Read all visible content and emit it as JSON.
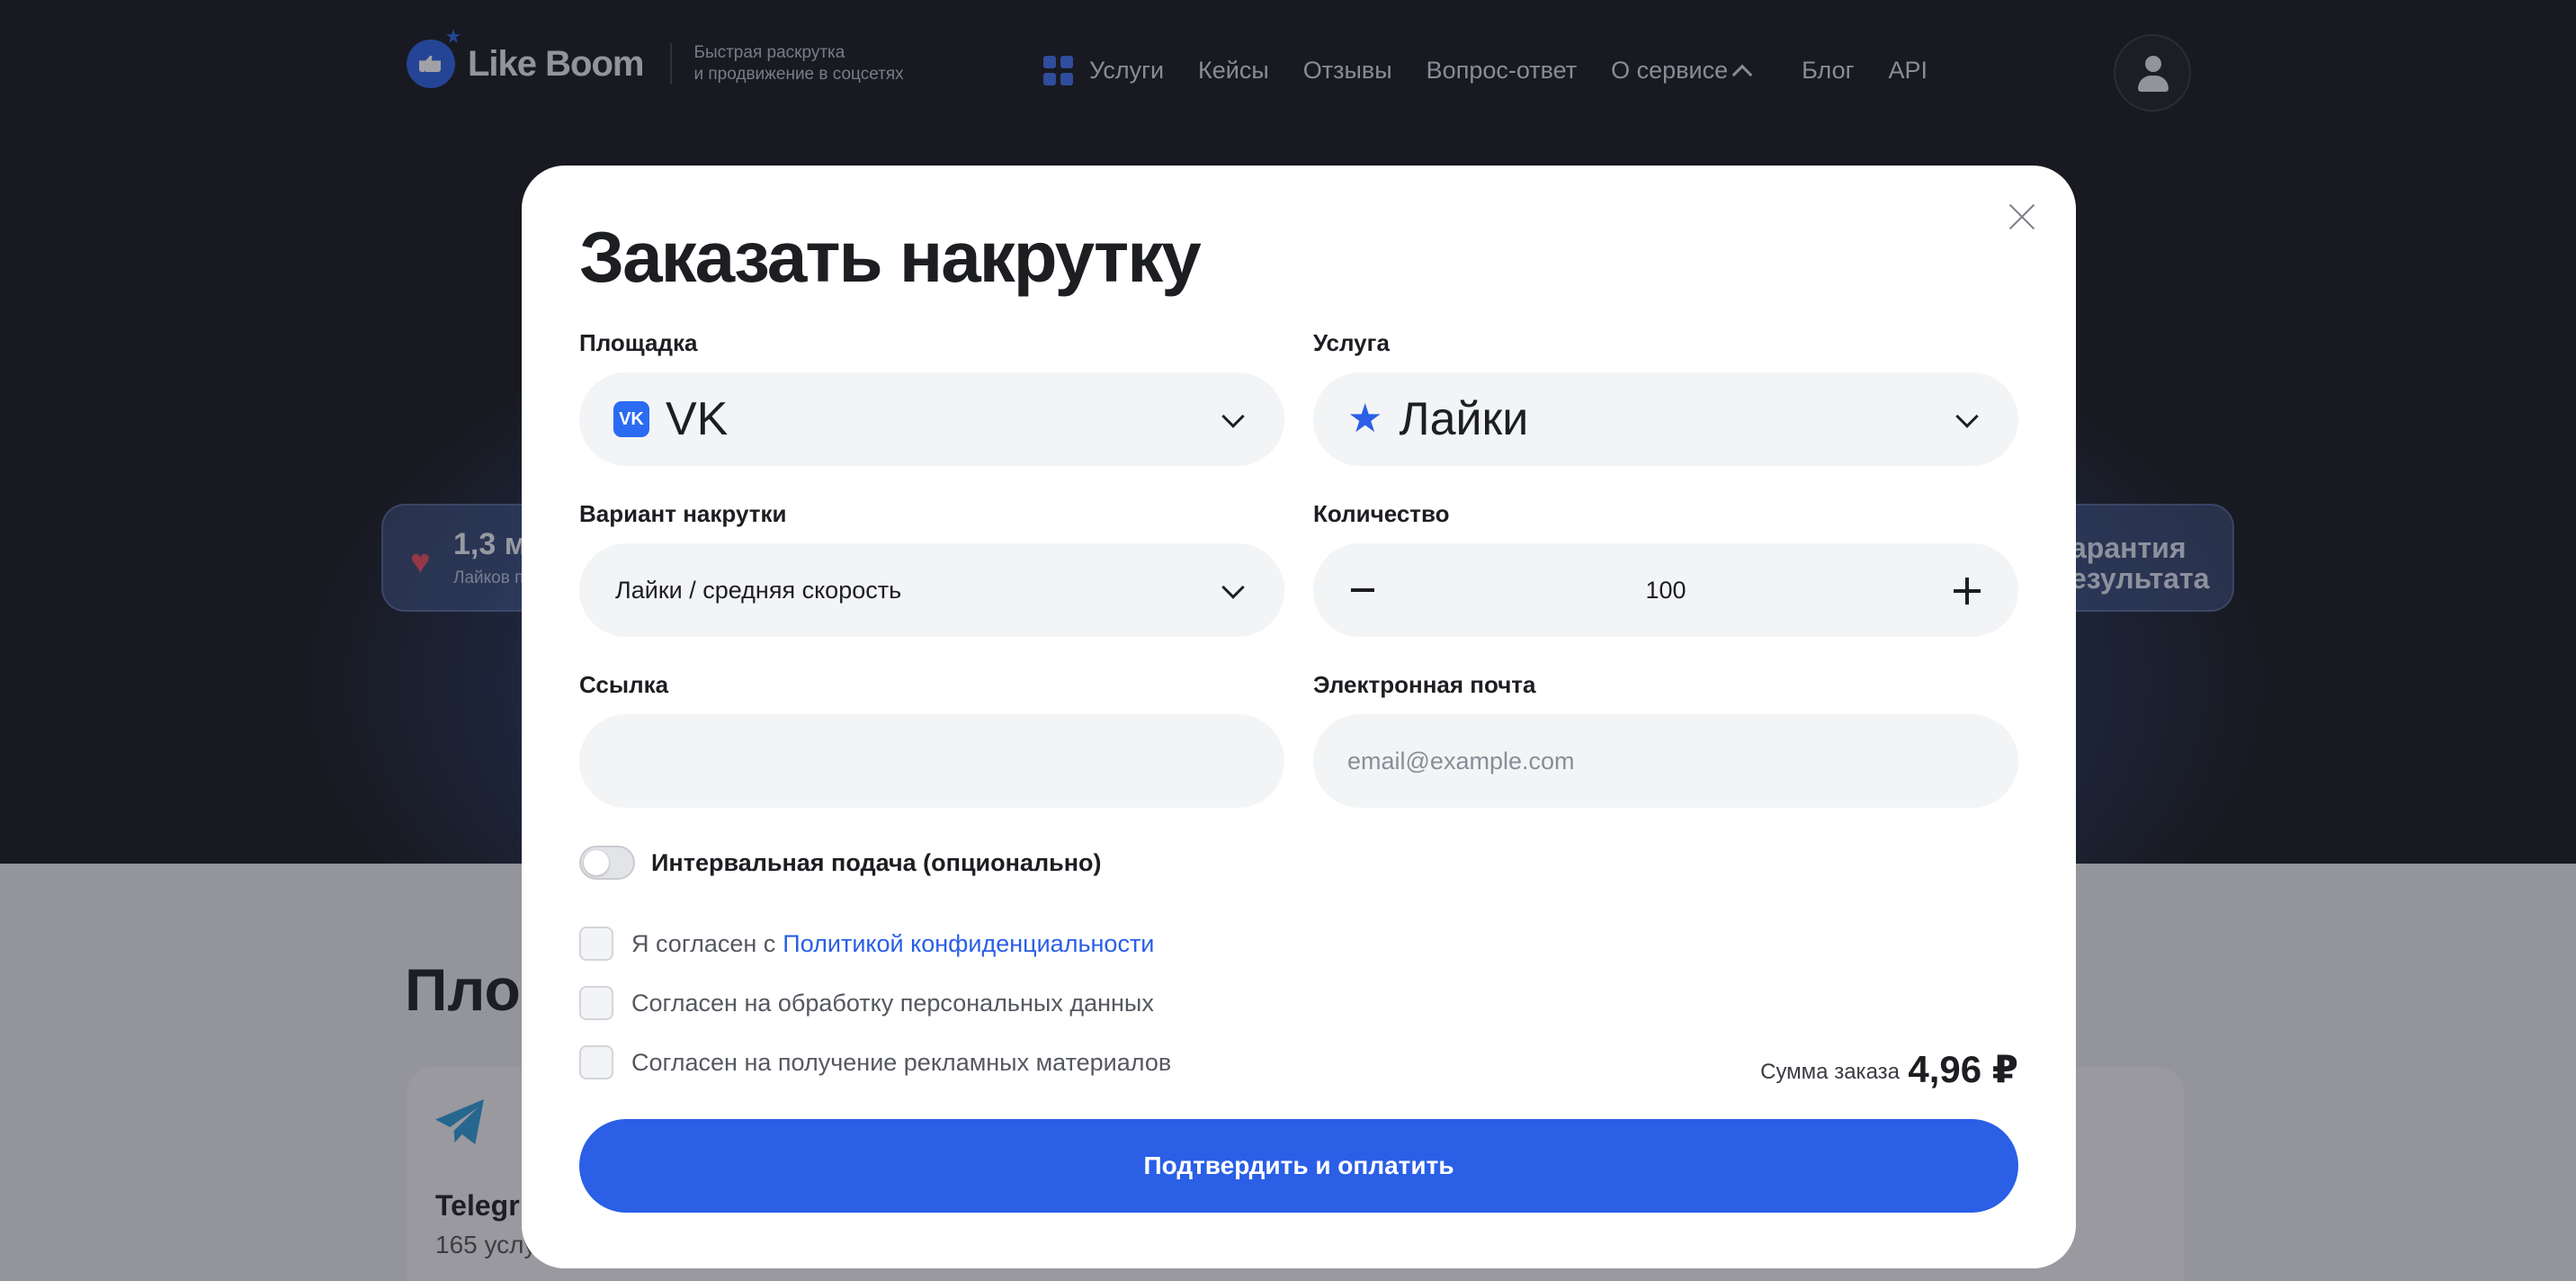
{
  "header": {
    "brand": "Like Boom",
    "tagline_line1": "Быстрая раскрутка",
    "tagline_line2": "и продвижение в соцсетях",
    "nav": {
      "services": "Услуги",
      "cases": "Кейсы",
      "reviews": "Отзывы",
      "faq": "Вопрос-ответ",
      "about": "О сервисе",
      "blog": "Блог",
      "api": "API"
    }
  },
  "background": {
    "stat_left_value": "1,3 м",
    "stat_left_label": "Лайков п",
    "stat_right_line1": "арантия",
    "stat_right_line2": "езультата",
    "section_title": "Пло",
    "card_name": "Telegr",
    "card_count": "165 услу"
  },
  "modal": {
    "title": "Заказать накрутку",
    "platform": {
      "label": "Площадка",
      "value": "VK",
      "icon_text": "VK"
    },
    "service": {
      "label": "Услуга",
      "value": "Лайки"
    },
    "variant": {
      "label": "Вариант накрутки",
      "value": "Лайки / средняя скорость"
    },
    "quantity": {
      "label": "Количество",
      "value": "100"
    },
    "link": {
      "label": "Ссылка",
      "placeholder": ""
    },
    "email": {
      "label": "Электронная почта",
      "placeholder": "email@example.com"
    },
    "interval_toggle": {
      "label": "Интервальная подача (опционально)",
      "enabled": false
    },
    "consents": {
      "privacy_prefix": "Я согласен с",
      "privacy_link": "Политикой конфиденциальности",
      "personal_data": "Согласен на обработку персональных данных",
      "marketing": "Согласен на получение рекламных материалов"
    },
    "total": {
      "label": "Сумма заказа",
      "value": "4,96 ₽"
    },
    "submit_label": "Подтвердить и оплатить"
  },
  "colors": {
    "accent": "#2a5fe6",
    "field_bg": "#f3f4f6"
  },
  "icons": [
    "logo-icon",
    "services-grid-icon",
    "chevron-up-icon",
    "user-icon",
    "close-icon",
    "vk-icon",
    "star-icon",
    "chevron-down-icon",
    "minus-icon",
    "plus-icon",
    "heart-icon",
    "telegram-icon"
  ]
}
